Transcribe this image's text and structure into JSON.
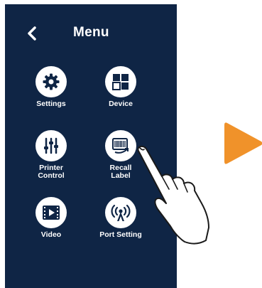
{
  "header": {
    "title": "Menu"
  },
  "menu": {
    "items": [
      {
        "label": "Settings",
        "icon": "gear-icon"
      },
      {
        "label": "Device",
        "icon": "grid-icon"
      },
      {
        "label": "Printer\nControl",
        "icon": "sliders-icon"
      },
      {
        "label": "Recall\nLabel",
        "icon": "recall-label-icon"
      },
      {
        "label": "Video",
        "icon": "video-icon"
      },
      {
        "label": "Port Setting",
        "icon": "antenna-icon"
      }
    ]
  },
  "colors": {
    "panel": "#0f2545",
    "icon_bg": "#ffffff",
    "arrow": "#f0922a"
  }
}
